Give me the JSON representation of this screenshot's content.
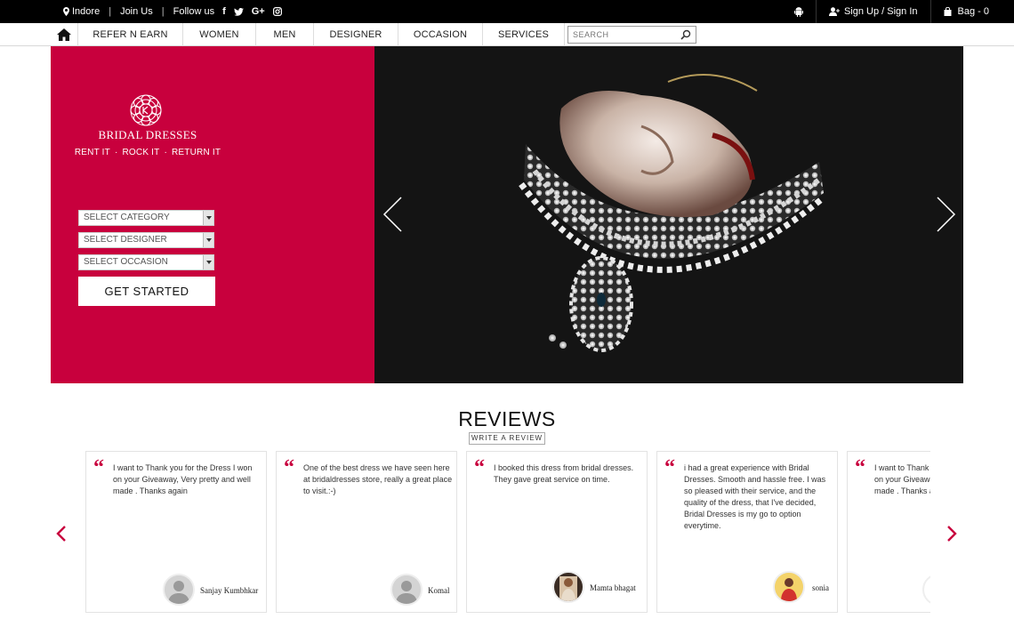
{
  "topbar": {
    "location": "Indore",
    "join": "Join Us",
    "follow": "Follow us",
    "social_f": "f",
    "social_gplus": "G+",
    "signup": "Sign Up / Sign In",
    "bag": "Bag - 0"
  },
  "nav": {
    "items": [
      "REFER N EARN",
      "WOMEN",
      "MEN",
      "DESIGNER",
      "OCCASION",
      "SERVICES"
    ],
    "search_placeholder": "SEARCH"
  },
  "hero": {
    "brand": "BRIDAL DRESSES",
    "tagline": [
      "RENT IT",
      "ROCK IT",
      "RETURN IT"
    ],
    "tagline_sep": "·",
    "select_category": "SELECT CATEGORY",
    "select_designer": "SELECT DESIGNER",
    "select_occasion": "SELECT OCCASION",
    "cta": "GET STARTED"
  },
  "reviews": {
    "title": "REVIEWS",
    "write": "WRITE A REVIEW",
    "quote_mark": "“",
    "items": [
      {
        "text": "I want to Thank you for the Dress I won on your Giveaway, Very pretty and well made . Thanks again",
        "name": "Sanjay Kumbhkar"
      },
      {
        "text": "One of the best dress we have seen here at bridaldresses store, really a great place to visit.:-)",
        "name": "Komal"
      },
      {
        "text": "I booked this dress from bridal dresses. They gave great service on time.",
        "name": "Mamta bhagat"
      },
      {
        "text": "i had a great experience with Bridal Dresses. Smooth and hassle free. I was so pleased with their service, and the quality of the dress, that I've decided, Bridal Dresses is my go to option everytime.",
        "name": "sonia"
      },
      {
        "text": "I want to Thank you for the Dress I won on your Giveaway, Very pretty and well made . Thanks again",
        "name": ""
      }
    ]
  },
  "colors": {
    "brand": "#c8003d",
    "topbar": "#000000",
    "hero_photo_bg": "#141414"
  }
}
